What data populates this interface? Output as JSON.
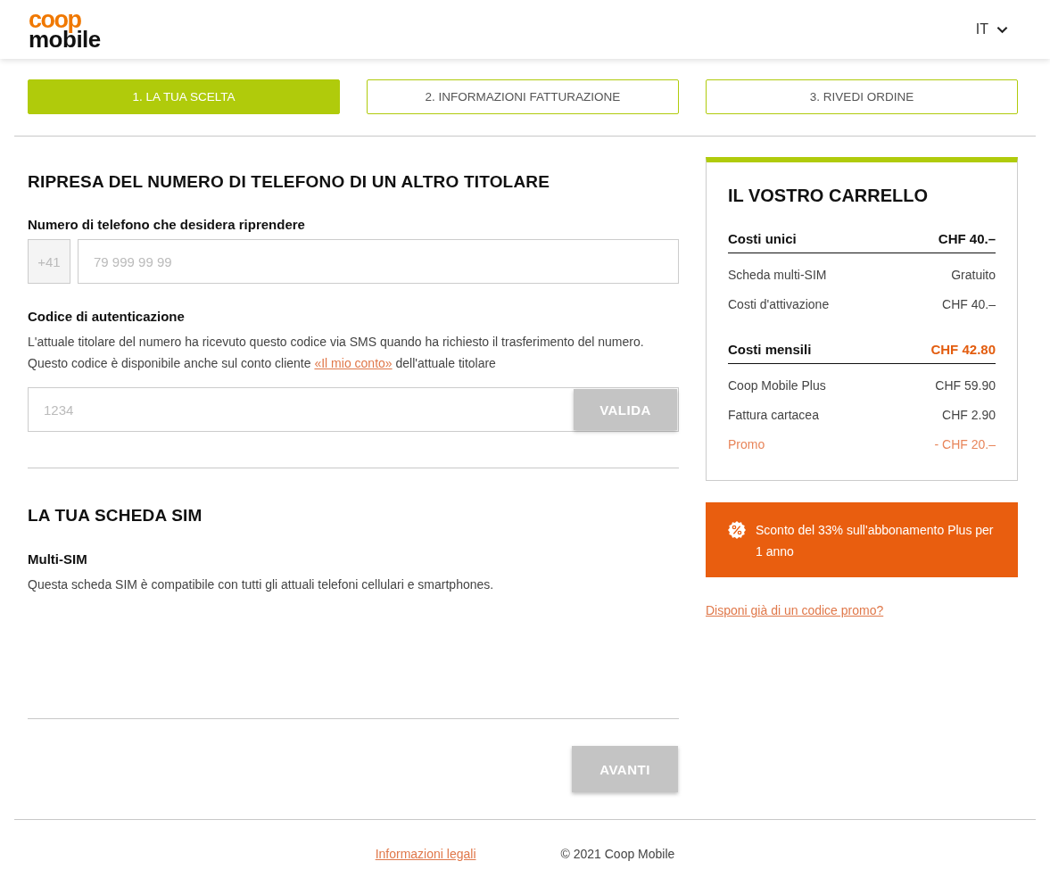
{
  "header": {
    "logo": {
      "line_1": "coop",
      "line_2": "mobile"
    },
    "language": "IT"
  },
  "steps": [
    {
      "label": "1. LA TUA SCELTA",
      "selected": true
    },
    {
      "label": "2. INFORMAZIONI FATTURAZIONE",
      "selected": false
    },
    {
      "label": "3. RIVEDI ORDINE",
      "selected": false
    }
  ],
  "number_transfer": {
    "title": "RIPRESA DEL NUMERO DI TELEFONO DI UN ALTRO TITOLARE",
    "phone_field": {
      "label": "Numero di telefono che desidera riprendere",
      "prefix": "+41",
      "placeholder": "79 999 99 99"
    },
    "auth_field": {
      "label": "Codice di autenticazione",
      "help_line_1": "L'attuale titolare del numero ha ricevuto questo codice via SMS quando ha richiesto il trasferimento del numero.",
      "help_line_2": "Questo codice è disponibile anche sul conto cliente",
      "help_link": "«Il mio conto»",
      "help_after": "dell'attuale titolare",
      "placeholder": "1234",
      "button": {
        "label": "VALIDA",
        "disabled": true
      }
    }
  },
  "sim_card": {
    "title": "LA TUA SCHEDA SIM",
    "name": "Multi-SIM",
    "description": "Questa scheda SIM è compatibile con tutti gli attuali telefoni cellulari e smartphones."
  },
  "next_button": {
    "label": "AVANTI",
    "disabled": true
  },
  "cart": {
    "title": "IL VOSTRO CARRELLO",
    "sections": [
      {
        "title": "Costi unici",
        "total": "CHF 40.–",
        "highlight": false,
        "rows": [
          {
            "kind": "item",
            "label": "Scheda multi-SIM",
            "value": "Gratuito"
          },
          {
            "kind": "item",
            "label": "Costi d'attivazione",
            "value": "CHF 40.–"
          }
        ]
      },
      {
        "title": "Costi mensili",
        "total": "CHF 42.80",
        "highlight": true,
        "rows": [
          {
            "kind": "item",
            "label": "Coop Mobile Plus",
            "value": "CHF 59.90"
          },
          {
            "kind": "item",
            "label": "Fattura cartacea",
            "value": "CHF 2.90"
          },
          {
            "kind": "discount",
            "label": "Promo",
            "value": "- CHF 20.–"
          }
        ]
      }
    ]
  },
  "promo_banner": {
    "text": "Sconto del 33% sull'abbonamento Plus per 1 anno"
  },
  "promo_code_link": "Disponi già di un codice promo?",
  "footer": {
    "legal_link": "Informazioni legali",
    "copyright": "© 2021 Coop Mobile"
  }
}
